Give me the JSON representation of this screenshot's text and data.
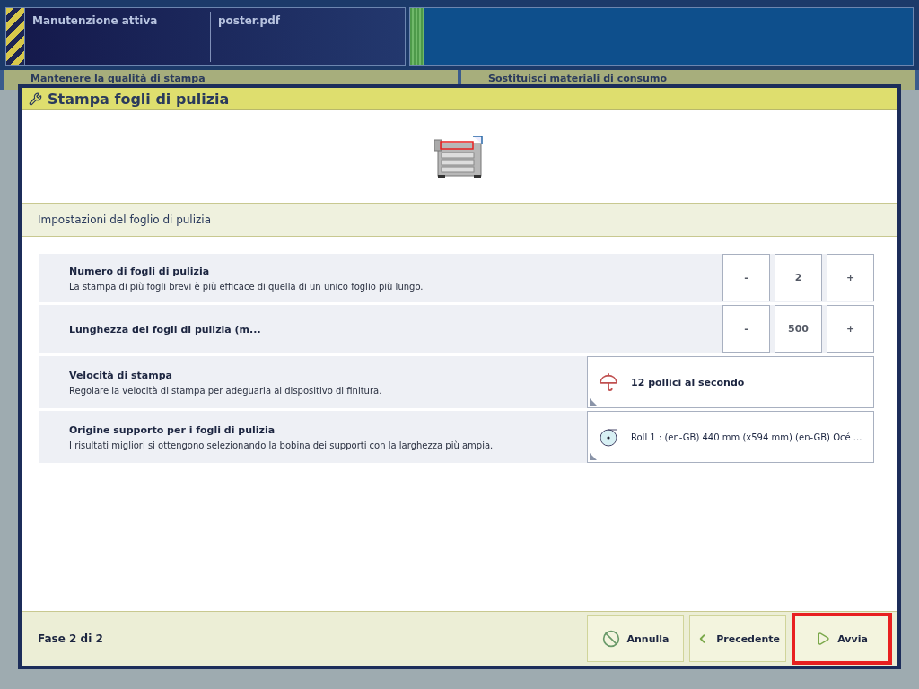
{
  "status_bar": {
    "job_state": "Manutenzione attiva",
    "document": "poster.pdf"
  },
  "background_tabs": [
    {
      "label": "Mantenere la qualità di stampa"
    },
    {
      "label": "Sostituisci materiali di consumo"
    }
  ],
  "dialog": {
    "title": "Stampa fogli di pulizia",
    "section": "Impostazioni del foglio di pulizia",
    "settings": [
      {
        "kind": "stepper",
        "label": "Numero di fogli di pulizia",
        "description": "La stampa di più fogli brevi è più efficace di quella di un unico foglio più lungo.",
        "decrement": "-",
        "value": "2",
        "increment": "+"
      },
      {
        "kind": "stepper",
        "label": "Lunghezza dei fogli di pulizia (m...",
        "decrement": "-",
        "value": "500",
        "increment": "+"
      },
      {
        "kind": "select",
        "label": "Velocità di stampa",
        "description": "Regolare la velocità di stampa per adeguarla al dispositivo di finitura.",
        "value": "12 pollici al secondo"
      },
      {
        "kind": "select",
        "label": "Origine supporto per i fogli di pulizia",
        "description": "I risultati migliori si ottengono selezionando la bobina dei supporti con la larghezza più ampia.",
        "value": "Roll 1 : (en-GB) 440 mm (x594 mm) (en-GB) Océ ..."
      }
    ],
    "step": "Fase 2 di 2",
    "buttons": [
      {
        "kind": "cancel",
        "label": "Annulla",
        "highlighted": false
      },
      {
        "kind": "back",
        "label": "Precedente",
        "highlighted": false
      },
      {
        "kind": "start",
        "label": "Avvia",
        "highlighted": true
      }
    ]
  }
}
